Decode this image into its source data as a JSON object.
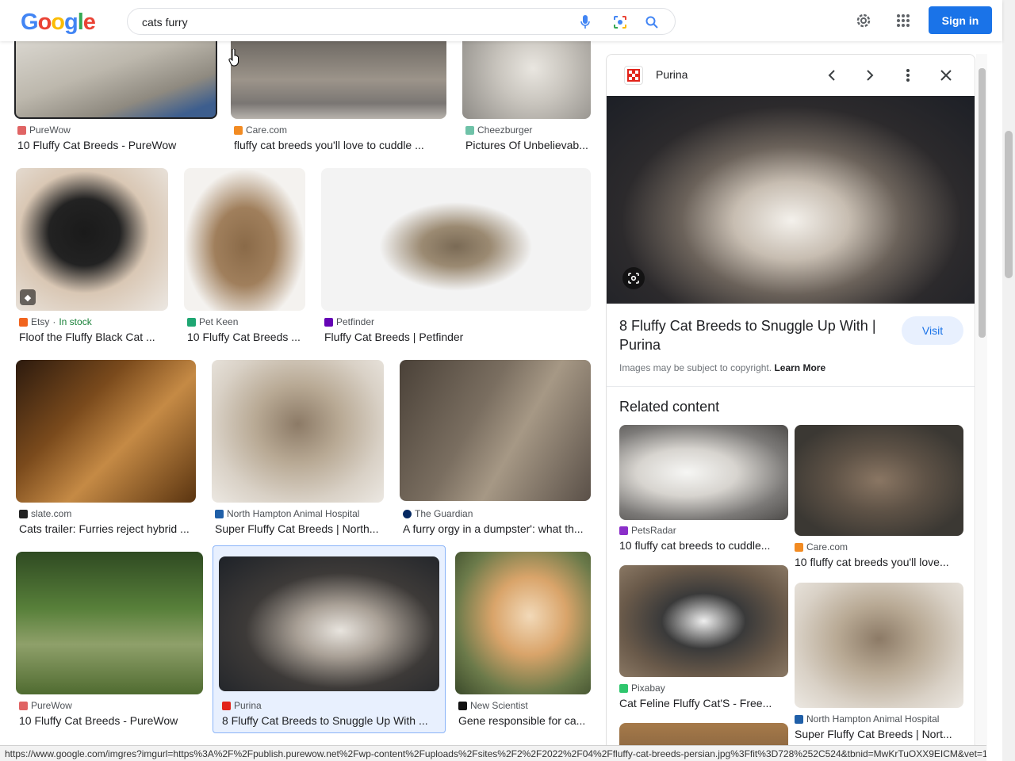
{
  "header": {
    "logo": [
      "G",
      "o",
      "o",
      "g",
      "l",
      "e"
    ],
    "search_value": "cats furry",
    "signin_label": "Sign in"
  },
  "grid": [
    {
      "source": "PureWow",
      "title": "10 Fluffy Cat Breeds - PureWow",
      "fav_color": "#e06464"
    },
    {
      "source": "Care.com",
      "title": "fluffy cat breeds you'll love to cuddle ...",
      "fav_color": "#f28b22"
    },
    {
      "source": "Cheezburger",
      "title": "Pictures Of Unbelievab...",
      "fav_color": "#6fc2a8"
    },
    {
      "source": "Etsy",
      "source_extra": "In stock",
      "title": "Floof the Fluffy Black Cat ...",
      "fav_color": "#f1641e"
    },
    {
      "source": "Pet Keen",
      "title": "10 Fluffy Cat Breeds ...",
      "fav_color": "#1ea672"
    },
    {
      "source": "Petfinder",
      "title": "Fluffy Cat Breeds | Petfinder",
      "fav_color": "#6504b5"
    },
    {
      "source": "slate.com",
      "title": "Cats trailer: Furries reject hybrid ...",
      "fav_color": "#222222"
    },
    {
      "source": "North Hampton Animal Hospital",
      "title": "Super Fluffy Cat Breeds | North...",
      "fav_color": "#1f5fa8"
    },
    {
      "source": "The Guardian",
      "title": "A furry orgy in a dumpster': what th...",
      "fav_color": "#052962"
    },
    {
      "source": "PureWow",
      "title": "10 Fluffy Cat Breeds - PureWow",
      "fav_color": "#e06464"
    },
    {
      "source": "Purina",
      "title": "8 Fluffy Cat Breeds to Snuggle Up With ...",
      "fav_color": "#e2231a"
    },
    {
      "source": "New Scientist",
      "title": "Gene responsible for ca...",
      "fav_color": "#111111"
    }
  ],
  "panel": {
    "source": "Purina",
    "title": "8 Fluffy Cat Breeds to Snuggle Up With | Purina",
    "visit_label": "Visit",
    "copyright": "Images may be subject to copyright.",
    "learn_more": "Learn More",
    "related_heading": "Related content",
    "related": [
      {
        "source": "PetsRadar",
        "title": "10 fluffy cat breeds to cuddle...",
        "fav_color": "#8b2fc9"
      },
      {
        "source": "Care.com",
        "title": "10 fluffy cat breeds you'll love...",
        "fav_color": "#f28b22"
      },
      {
        "source": "Pixabay",
        "title": "Cat Feline Fluffy Cat'S - Free...",
        "fav_color": "#2ec66d"
      },
      {
        "source": "North Hampton Animal Hospital",
        "title": "Super Fluffy Cat Breeds | Nort...",
        "fav_color": "#1f5fa8"
      }
    ]
  },
  "status_url": "https://www.google.com/imgres?imgurl=https%3A%2F%2Fpublish.purewow.net%2Fwp-content%2Fuploads%2Fsites%2F2%2F2022%2F04%2Ffluffy-cat-breeds-persian.jpg%3Ffit%3D728%252C524&tbnid=MwKrTuOXX9EICM&vet=12..."
}
